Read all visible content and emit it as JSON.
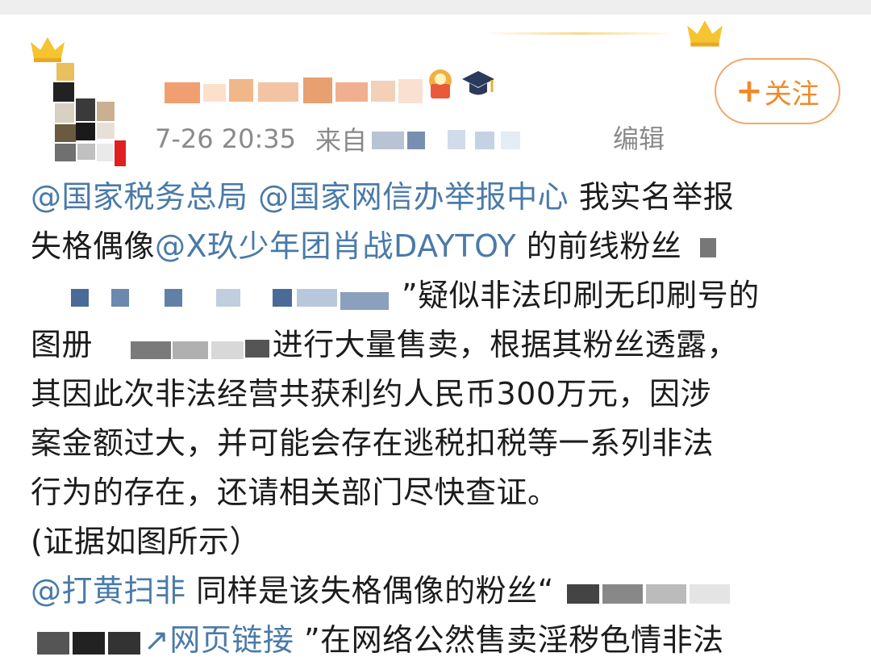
{
  "post": {
    "timestamp": "7-26 20:35",
    "source_prefix": "来自",
    "edit_label": "编辑",
    "follow_label": "关注",
    "follow_plus": "+",
    "body": {
      "l1_m1": "@国家税务总局",
      "l1_m2": "@国家网信办举报中心",
      "l1_t": " 我实名举报",
      "l2_t1": "失格偶像",
      "l2_m": "@X玖少年团肖战DAYTOY",
      "l2_t2": " 的前线粉丝",
      "l3_t": "”疑似非法印刷无印刷号的",
      "l4_t1": "图册",
      "l4_t2": "进行大量售卖，根据其粉丝透露，",
      "l5": "其因此次非法经营共获利约人民币300万元，因涉",
      "l6": "案金额过大，并可能会存在逃税扣税等一系列非法",
      "l7": "行为的存在，还请相关部门尽快查证。",
      "l8": "(证据如图所示）",
      "l9_m": "@打黄扫非",
      "l9_t": " 同样是该失格偶像的粉丝“",
      "l10_link": "网页链接",
      "l10_t": " ”在网络公然售卖淫秽色情非法"
    }
  },
  "colors": {
    "mention": "#4a7aa8",
    "follow": "#f08a2a",
    "meta": "#8a8a8a"
  },
  "icons": [
    "crown-icon",
    "medal-badge-icon",
    "graduation-cap-icon",
    "link-icon"
  ]
}
